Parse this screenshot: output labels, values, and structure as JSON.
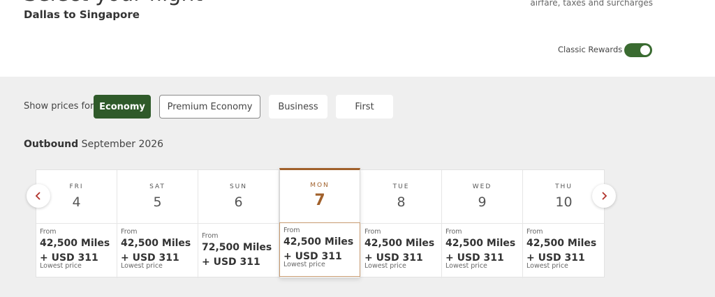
{
  "header": {
    "title": "Select your flight",
    "route": "Dallas to Singapore",
    "fare_note": "airfare, taxes and surcharges",
    "toggle_label": "Classic Rewards",
    "toggle_on": true
  },
  "cabin_filter": {
    "label": "Show prices for:",
    "options": [
      {
        "label": "Economy",
        "state": "active"
      },
      {
        "label": "Premium Economy",
        "state": "hover"
      },
      {
        "label": "Business",
        "state": "default"
      },
      {
        "label": "First",
        "state": "default"
      }
    ]
  },
  "outbound": {
    "label": "Outbound",
    "month": "September 2026"
  },
  "calendar": {
    "days": [
      {
        "dow": "FRI",
        "date": "4",
        "from": "From",
        "miles": "42,500 Miles",
        "usd": "+ USD 311",
        "note": "Lowest price"
      },
      {
        "dow": "SAT",
        "date": "5",
        "from": "From",
        "miles": "42,500 Miles",
        "usd": "+ USD 311",
        "note": "Lowest price"
      },
      {
        "dow": "SUN",
        "date": "6",
        "from": "From",
        "miles": "72,500 Miles",
        "usd": "+ USD 311",
        "note": ""
      },
      {
        "dow": "MON",
        "date": "7",
        "from": "From",
        "miles": "42,500 Miles",
        "usd": "+ USD 311",
        "note": "Lowest price",
        "selected": true
      },
      {
        "dow": "TUE",
        "date": "8",
        "from": "From",
        "miles": "42,500 Miles",
        "usd": "+ USD 311",
        "note": "Lowest price"
      },
      {
        "dow": "WED",
        "date": "9",
        "from": "From",
        "miles": "42,500 Miles",
        "usd": "+ USD 311",
        "note": "Lowest price"
      },
      {
        "dow": "THU",
        "date": "10",
        "from": "From",
        "miles": "42,500 Miles",
        "usd": "+ USD 311",
        "note": "Lowest price"
      }
    ]
  },
  "nav": {
    "prev_icon": "chevron-left-icon",
    "next_icon": "chevron-right-icon"
  },
  "colors": {
    "brand_green": "#2f5a2a",
    "selected_accent": "#a0602b",
    "nav_arrow": "#b0322b"
  }
}
